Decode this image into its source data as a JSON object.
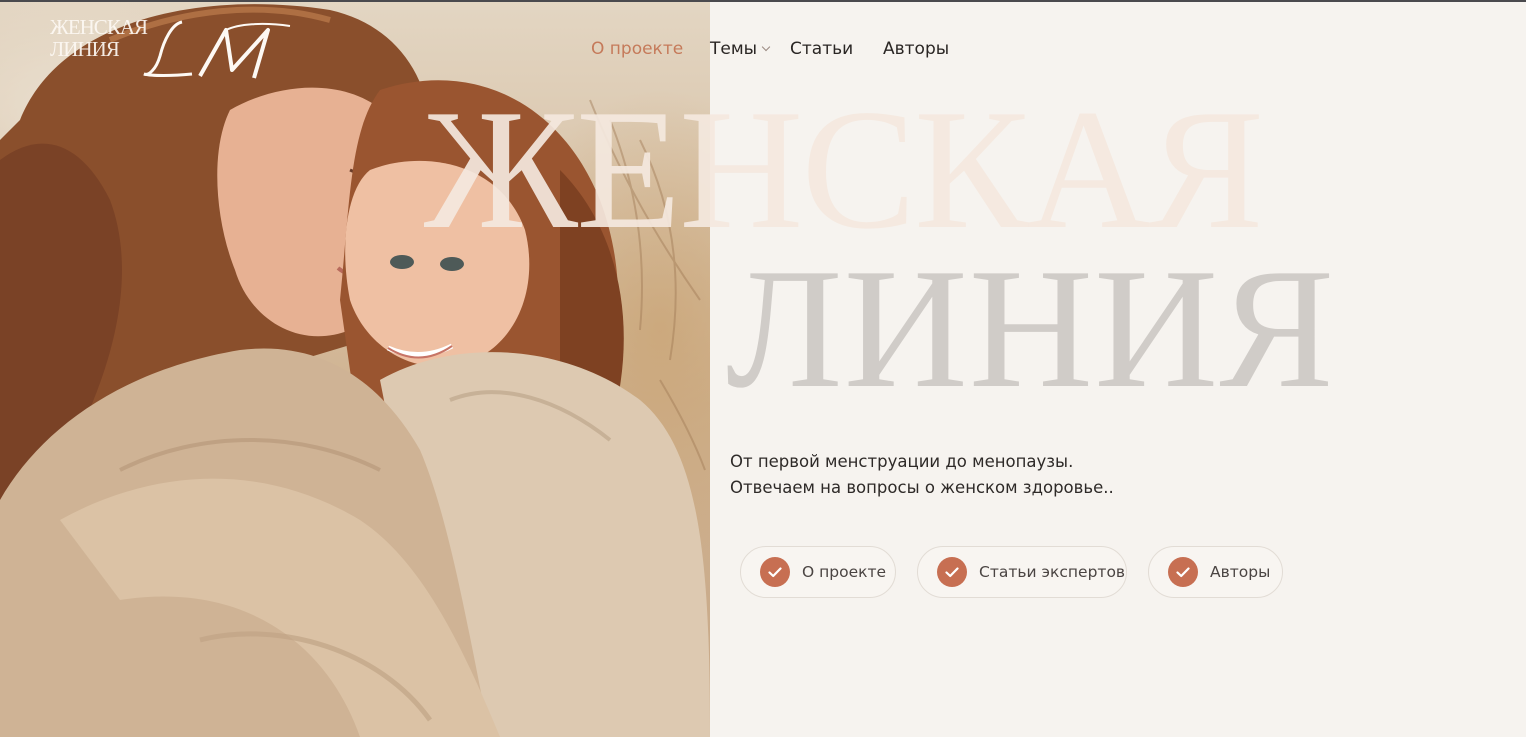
{
  "logo": {
    "text_line1": "ЖЕНСКАЯ",
    "text_line2": "ЛИНИЯ",
    "monogram": "LM"
  },
  "nav": {
    "items": [
      {
        "label": "О проекте",
        "active": true
      },
      {
        "label": "Темы",
        "has_dropdown": true
      },
      {
        "label": "Статьи"
      },
      {
        "label": "Авторы"
      }
    ]
  },
  "hero": {
    "title_line1": "ЖЕНСКАЯ",
    "title_line2": "ЛИНИЯ",
    "tagline_line1": "От первой менструации до менопаузы.",
    "tagline_line2": "Отвечаем на вопросы о женском здоровье.."
  },
  "pills": [
    {
      "label": "О проекте",
      "icon": "check-icon"
    },
    {
      "label": "Статьи экспертов",
      "icon": "check-icon"
    },
    {
      "label": "Авторы",
      "icon": "check-icon"
    }
  ],
  "colors": {
    "background": "#f6f3ef",
    "accent": "#c76f52",
    "nav_active": "#c57a5a",
    "hero_text": "#d0ccc8",
    "body_text": "#2e2a28"
  }
}
